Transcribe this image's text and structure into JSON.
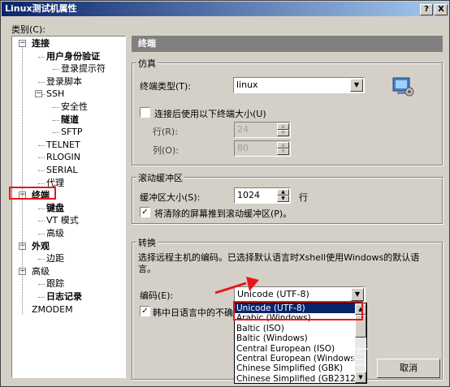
{
  "window": {
    "title": "Linux测试机属性",
    "help_btn": "?",
    "close_btn": "X"
  },
  "category_label": "类别(C):",
  "tree": [
    {
      "label": "连接",
      "bold": true,
      "level": 0
    },
    {
      "label": "用户身份验证",
      "bold": true,
      "level": 1
    },
    {
      "label": "登录提示符",
      "bold": false,
      "level": 2
    },
    {
      "label": "登录脚本",
      "bold": false,
      "level": 1
    },
    {
      "label": "SSH",
      "bold": false,
      "level": 1
    },
    {
      "label": "安全性",
      "bold": false,
      "level": 2
    },
    {
      "label": "隧道",
      "bold": true,
      "level": 2
    },
    {
      "label": "SFTP",
      "bold": false,
      "level": 2
    },
    {
      "label": "TELNET",
      "bold": false,
      "level": 1
    },
    {
      "label": "RLOGIN",
      "bold": false,
      "level": 1
    },
    {
      "label": "SERIAL",
      "bold": false,
      "level": 1
    },
    {
      "label": "代理",
      "bold": false,
      "level": 1
    },
    {
      "label": "终端",
      "bold": true,
      "level": 0
    },
    {
      "label": "键盘",
      "bold": true,
      "level": 1
    },
    {
      "label": "VT 模式",
      "bold": false,
      "level": 1
    },
    {
      "label": "高级",
      "bold": false,
      "level": 1
    },
    {
      "label": "外观",
      "bold": true,
      "level": 0
    },
    {
      "label": "边距",
      "bold": false,
      "level": 1
    },
    {
      "label": "高级",
      "bold": false,
      "level": 0
    },
    {
      "label": "跟踪",
      "bold": false,
      "level": 1
    },
    {
      "label": "日志记录",
      "bold": true,
      "level": 1
    },
    {
      "label": "ZMODEM",
      "bold": false,
      "level": 0
    }
  ],
  "panel": {
    "header": "终端",
    "emulation": {
      "title": "仿真",
      "terminal_type_label": "终端类型(T):",
      "terminal_type_value": "linux",
      "use_size_label": "连接后使用以下终端大小(U)",
      "rows_label": "行(R):",
      "rows_value": "24",
      "cols_label": "列(O):",
      "cols_value": "80"
    },
    "scrollback": {
      "title": "滚动缓冲区",
      "size_label": "缓冲区大小(S):",
      "size_value": "1024",
      "unit": "行",
      "push_label": "将清除的屏幕推到滚动缓冲区(P)。"
    },
    "translation": {
      "title": "转换",
      "desc": "选择远程主机的编码。已选择默认语言时Xshell使用Windows的默认语言。",
      "encoding_label": "编码(E):",
      "encoding_value": "Unicode (UTF-8)",
      "cjk_label": "韩中日语言中的不确",
      "options": [
        "Unicode (UTF-8)",
        "Arabic (Windows)",
        "Baltic (ISO)",
        "Baltic (Windows)",
        "Central European (ISO)",
        "Central European (Windows)",
        "Chinese Simplified (GBK)",
        "Chinese Simplified (GB2312)"
      ]
    }
  },
  "buttons": {
    "cancel": "取消"
  },
  "watermark": "百"
}
